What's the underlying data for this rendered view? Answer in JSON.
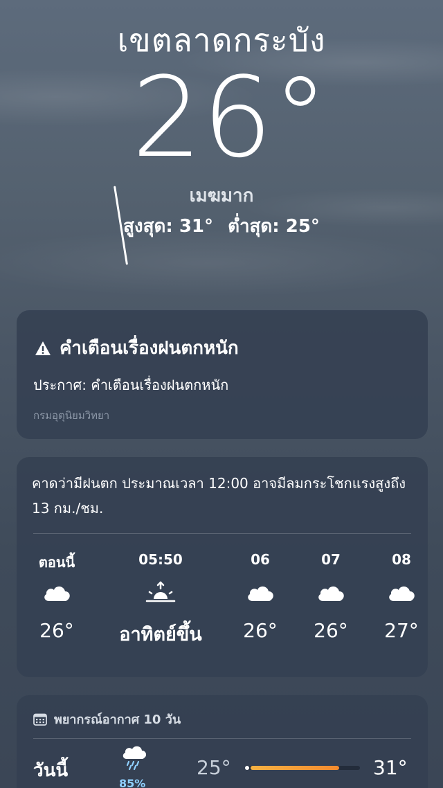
{
  "header": {
    "city": "เขตลาดกระบัง",
    "temperature": "26°",
    "condition": "เมฆมาก",
    "high": "สูงสุด: 31°",
    "low": "ต่ำสุด: 25°"
  },
  "alert": {
    "icon": "warning-triangle-icon",
    "title": "คำเตือนเรื่องฝนตกหนัก",
    "body": "ประกาศ: คำเตือนเรื่องฝนตกหนัก",
    "source": "กรมอุตุนิยมวิทยา"
  },
  "hourly": {
    "summary": "คาดว่ามีฝนตก ประมาณเวลา 12:00 อาจมีลมกระโชกแรงสูงถึง 13 กม./ชม.",
    "items": [
      {
        "label": "ตอนนี้",
        "icon": "cloud-icon",
        "temp": "26°"
      },
      {
        "label": "05:50",
        "icon": "sunrise-icon",
        "temp": "อาทิตย์ขึ้น"
      },
      {
        "label": "06",
        "icon": "cloud-icon",
        "temp": "26°"
      },
      {
        "label": "07",
        "icon": "cloud-icon",
        "temp": "26°"
      },
      {
        "label": "08",
        "icon": "cloud-icon",
        "temp": "27°"
      }
    ]
  },
  "forecast": {
    "title": "พยากรณ์อากาศ 10 วัน",
    "icon": "calendar-icon",
    "rows": [
      {
        "day": "วันนี้",
        "icon": "cloud-rain-icon",
        "precip": "85%",
        "low": "25°",
        "high": "31°"
      }
    ]
  },
  "colors": {
    "bar_start": "#f6b243",
    "bar_end": "#f38a2e",
    "precip": "#8fd0ff"
  }
}
